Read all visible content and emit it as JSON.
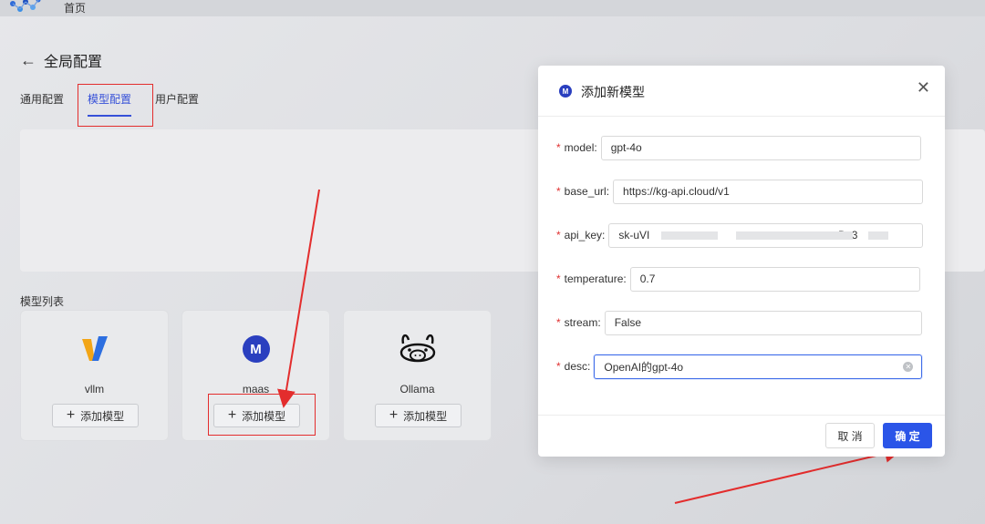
{
  "topbar": {
    "home_label": "首页"
  },
  "header": {
    "back_glyph": "←",
    "title": "全局配置"
  },
  "tabs": [
    {
      "label": "通用配置",
      "active": false
    },
    {
      "label": "模型配置",
      "active": true
    },
    {
      "label": "用户配置",
      "active": false
    }
  ],
  "model_list": {
    "title": "模型列表",
    "cards": [
      {
        "name": "vllm",
        "icon": "vllm-logo-icon",
        "button_label": "添加模型"
      },
      {
        "name": "maas",
        "icon": "maas-logo-icon",
        "icon_letter": "M",
        "button_label": "添加模型"
      },
      {
        "name": "Ollama",
        "icon": "ollama-llama-icon",
        "button_label": "添加模型"
      }
    ]
  },
  "modal": {
    "icon_letter": "M",
    "title": "添加新模型",
    "close_glyph": "✕",
    "fields": {
      "model": {
        "label": "model:",
        "value": "gpt-4o"
      },
      "base_url": {
        "label": "base_url:",
        "value": "https://kg-api.cloud/v1"
      },
      "api_key": {
        "label": "api_key:",
        "value": "sk-uVI                                                             .Dc3"
      },
      "temperature": {
        "label": "temperature:",
        "value": "0.7"
      },
      "stream": {
        "label": "stream:",
        "value": "False"
      },
      "desc": {
        "label": "desc:",
        "value": "OpenAI的gpt-4o"
      }
    },
    "required_marker": "*",
    "cancel_label": "取 消",
    "ok_label": "确 定"
  },
  "colors": {
    "accent": "#2b55e8",
    "annotation_red": "#e32d2d",
    "tab_active": "#3650d8"
  }
}
